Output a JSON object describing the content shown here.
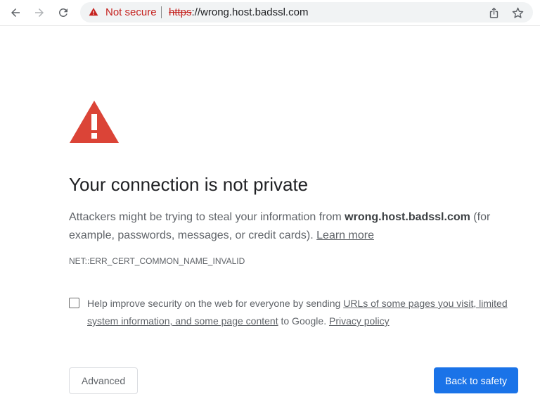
{
  "toolbar": {
    "back_icon": "arrow-left-icon",
    "forward_icon": "arrow-right-icon",
    "reload_icon": "reload-icon",
    "security_chip": {
      "icon": "warning-triangle-icon",
      "label": "Not secure",
      "color": "#c5221f"
    },
    "url": {
      "scheme": "https",
      "rest": "://wrong.host.badssl.com"
    },
    "share_icon": "share-icon",
    "bookmark_icon": "star-icon"
  },
  "interstitial": {
    "icon": "red-warning-triangle-icon",
    "icon_color": "#db4437",
    "heading": "Your connection is not private",
    "explanation": {
      "before": "Attackers might be trying to steal your information from ",
      "host": "wrong.host.badssl.com",
      "after": " (for example, passwords, messages, or credit cards). ",
      "learn_more": "Learn more"
    },
    "error_code": "NET::ERR_CERT_COMMON_NAME_INVALID",
    "optin": {
      "checked": false,
      "before": "Help improve security on the web for everyone by sending ",
      "link1": "URLs of some pages you visit, limited system information, and some page content",
      "middle": " to Google. ",
      "link2": "Privacy policy"
    },
    "buttons": {
      "advanced": "Advanced",
      "back_to_safety": "Back to safety"
    },
    "primary_color": "#1a73e8"
  }
}
